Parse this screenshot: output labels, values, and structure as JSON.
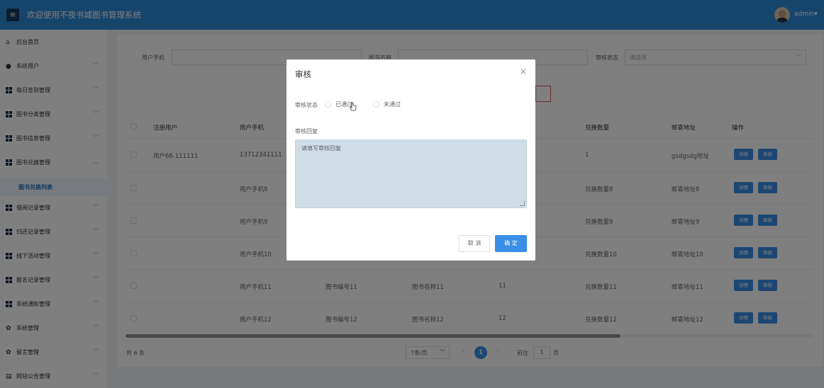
{
  "header": {
    "menu_icon": "hamburger-icon",
    "title": "欢迎使用不夜书城图书管理系统",
    "user": "admin",
    "user_caret": "▾"
  },
  "sidebar": {
    "items": [
      {
        "label": "后台首页",
        "icon": "home-icon"
      },
      {
        "label": "系统用户",
        "icon": "user-icon"
      },
      {
        "label": "每日签到管理",
        "icon": "grid-icon"
      },
      {
        "label": "图书分类管理",
        "icon": "grid-icon"
      },
      {
        "label": "图书信息管理",
        "icon": "grid-icon"
      },
      {
        "label": "图书兑换管理",
        "icon": "grid-icon",
        "expanded": true
      },
      {
        "label": "借阅记录管理",
        "icon": "grid-icon"
      },
      {
        "label": "归还记录管理",
        "icon": "grid-icon"
      },
      {
        "label": "线下活动管理",
        "icon": "grid-icon"
      },
      {
        "label": "报名记录管理",
        "icon": "grid-icon"
      },
      {
        "label": "系统通知管理",
        "icon": "grid-icon"
      },
      {
        "label": "系统管理",
        "icon": "gear-icon"
      },
      {
        "label": "留言管理",
        "icon": "gear-icon"
      },
      {
        "label": "网站公告管理",
        "icon": "doc-icon"
      }
    ],
    "subitem": "图书兑换列表",
    "arrow_down": "﹀",
    "arrow_up": "︿"
  },
  "search": {
    "phone_label": "用户手机",
    "phone_value": "",
    "book_name_label": "图书名称",
    "status_label": "审核状态",
    "status_placeholder": "请选择"
  },
  "table": {
    "headers": [
      "注册用户",
      "用户手机",
      "兑换数量",
      "邮寄地址",
      "操作"
    ],
    "rows": [
      {
        "user": "用户66-111111",
        "phone": "13712341111",
        "code": "",
        "name": "",
        "num": "",
        "qty": "1",
        "addr": "gsdgsdg地址"
      },
      {
        "user": "",
        "phone": "用户手机8",
        "code": "",
        "name": "",
        "num": "",
        "qty": "兑换数量8",
        "addr": "邮寄地址8"
      },
      {
        "user": "",
        "phone": "用户手机9",
        "code": "",
        "name": "",
        "num": "",
        "qty": "兑换数量9",
        "addr": "邮寄地址9"
      },
      {
        "user": "",
        "phone": "用户手机10",
        "code": "",
        "name": "",
        "num": "",
        "qty": "兑换数量10",
        "addr": "邮寄地址10"
      },
      {
        "user": "",
        "phone": "用户手机11",
        "code": "图书编号11",
        "name": "图书名称11",
        "num": "11",
        "qty": "兑换数量11",
        "addr": "邮寄地址11"
      },
      {
        "user": "",
        "phone": "用户手机12",
        "code": "图书编号12",
        "name": "图书名称12",
        "num": "12",
        "qty": "兑换数量12",
        "addr": "邮寄地址12"
      }
    ],
    "detail_btn": "详情",
    "audit_btn": "审核"
  },
  "pagination": {
    "total": "共 6 条",
    "page_size": "7条/页",
    "prev": "‹",
    "next": "›",
    "current_page": "1",
    "goto_label": "前往",
    "goto_value": "1",
    "page_unit": "页"
  },
  "modal": {
    "title": "审核",
    "close": "×",
    "status_label": "审核状态",
    "option_pass": "已通过",
    "option_fail": "未通过",
    "reply_label": "审核回复",
    "reply_placeholder": "请填写审核回复",
    "cancel": "取 消",
    "confirm": "确 定"
  },
  "colors": {
    "header": "#2d8bd8",
    "primary": "#3a8ee6",
    "textarea": "#cfdde7"
  }
}
